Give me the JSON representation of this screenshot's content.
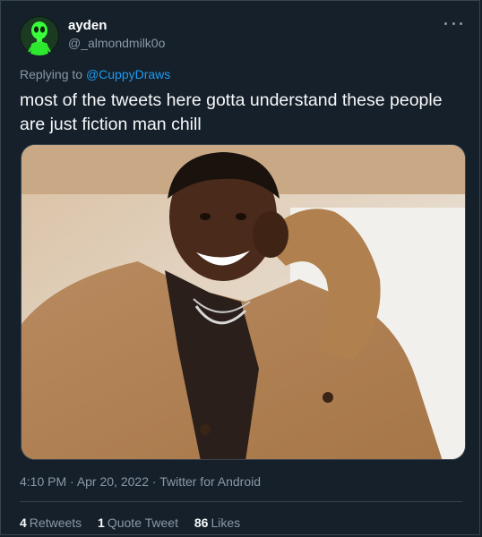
{
  "author": {
    "name": "ayden",
    "handle": "@_almondmilk0o",
    "avatar_icon": "green-alien-avatar-icon"
  },
  "more_icon": "more-options-icon",
  "reply": {
    "prefix": "Replying to ",
    "target": "@CuppyDraws"
  },
  "tweet": {
    "text": "most of the tweets here gotta understand these people are just fiction man chill"
  },
  "media": {
    "description_icon": "meme-photo"
  },
  "meta": {
    "time": "4:10 PM",
    "sep1": " · ",
    "date": "Apr 20, 2022",
    "sep2": " · ",
    "source": "Twitter for Android"
  },
  "stats": {
    "retweets_count": "4",
    "retweets_label": "Retweets",
    "quotes_count": "1",
    "quotes_label": "Quote Tweet",
    "likes_count": "86",
    "likes_label": "Likes"
  },
  "colors": {
    "background": "#15202b",
    "link": "#1d9bf0",
    "muted": "#8b98a5",
    "border": "#38444d"
  }
}
